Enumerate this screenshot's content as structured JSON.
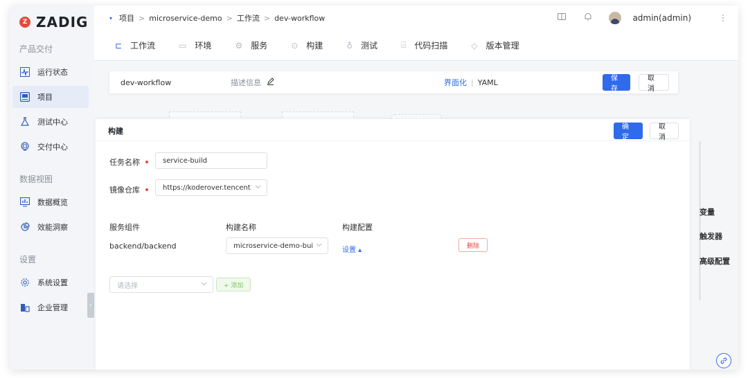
{
  "app": {
    "logo_mark": "Z",
    "logo_text": "ZADIG"
  },
  "sidebar": {
    "sections": [
      {
        "title": "产品交付",
        "items": [
          {
            "label": "运行状态",
            "icon": "pulse-icon"
          },
          {
            "label": "项目",
            "icon": "project-icon",
            "active": true
          },
          {
            "label": "测试中心",
            "icon": "flask-icon"
          },
          {
            "label": "交付中心",
            "icon": "delivery-icon"
          }
        ]
      },
      {
        "title": "数据视图",
        "items": [
          {
            "label": "数据概览",
            "icon": "monitor-chart-icon"
          },
          {
            "label": "效能洞察",
            "icon": "pie-chart-icon"
          }
        ]
      },
      {
        "title": "设置",
        "items": [
          {
            "label": "系统设置",
            "icon": "gear-icon"
          },
          {
            "label": "企业管理",
            "icon": "building-icon"
          }
        ]
      }
    ],
    "collapse_glyph": "‹"
  },
  "header": {
    "breadcrumb": [
      "项目",
      "microservice-demo",
      "工作流",
      "dev-workflow"
    ],
    "breadcrumb_sep": ">",
    "caret_glyph": "▾",
    "user": "admin(admin)",
    "more_glyph": "⋮"
  },
  "tabs": [
    {
      "label": "工作流",
      "icon": "workflow-icon",
      "glyph": "⊏",
      "active": true
    },
    {
      "label": "环境",
      "icon": "environment-icon",
      "glyph": "▭"
    },
    {
      "label": "服务",
      "icon": "service-icon",
      "glyph": "⚙"
    },
    {
      "label": "构建",
      "icon": "build-icon",
      "glyph": "⊙"
    },
    {
      "label": "测试",
      "icon": "test-icon",
      "glyph": "♁"
    },
    {
      "label": "代码扫描",
      "icon": "scan-icon",
      "glyph": "⌸"
    },
    {
      "label": "版本管理",
      "icon": "version-icon",
      "glyph": "◇"
    }
  ],
  "workflow_bar": {
    "name": "dev-workflow",
    "description_label": "描述信息",
    "mode_ui": "界面化",
    "mode_sep": "|",
    "mode_yaml": "YAML",
    "save": "保存",
    "cancel": "取消"
  },
  "build_panel": {
    "title": "构建",
    "confirm": "确定",
    "cancel": "取消",
    "task_name_label": "任务名称",
    "task_name_value": "service-build",
    "registry_label": "镜像仓库",
    "registry_value": "https://koderover.tencent",
    "columns": [
      "服务组件",
      "构建名称",
      "构建配置"
    ],
    "rows": [
      {
        "component": "backend/backend",
        "build_name": "microservice-demo-bui",
        "config_link": "设置 ▴",
        "delete": "删除"
      }
    ],
    "select_placeholder": "请选择",
    "add": "+ 添加"
  },
  "right_menu": [
    "变量",
    "触发器",
    "高级配置"
  ],
  "colors": {
    "primary": "#2f6bea",
    "danger": "#e64a3c",
    "sidebar_active": "#e5ecf8"
  }
}
